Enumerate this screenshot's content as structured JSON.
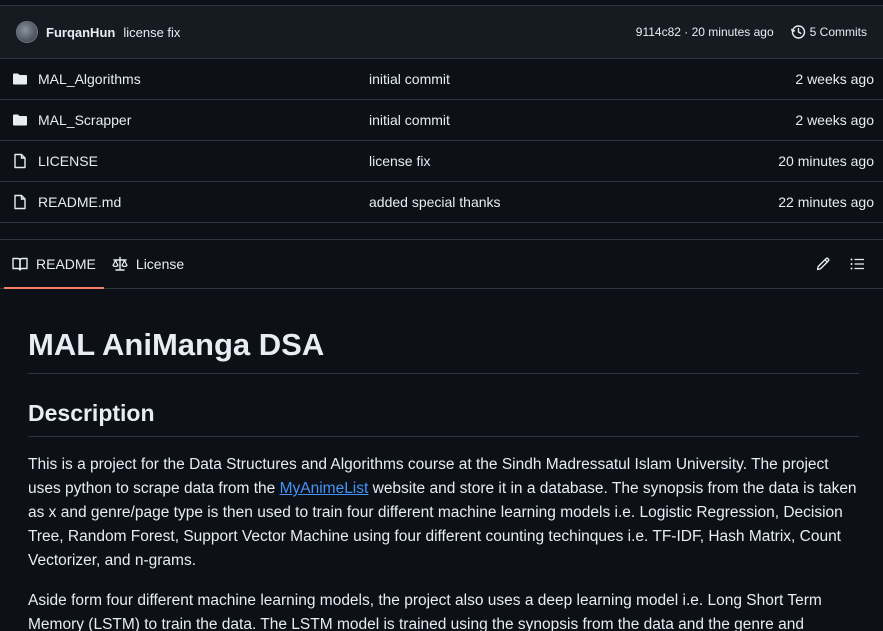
{
  "commit": {
    "author": "FurqanHun",
    "message": "license fix",
    "hash_time": "9114c82 · 20 minutes ago",
    "commits_label": "5 Commits"
  },
  "files": [
    {
      "name": "MAL_Algorithms",
      "type": "folder",
      "commit": "initial commit",
      "age": "2 weeks ago"
    },
    {
      "name": "MAL_Scrapper",
      "type": "folder",
      "commit": "initial commit",
      "age": "2 weeks ago"
    },
    {
      "name": "LICENSE",
      "type": "file",
      "commit": "license fix",
      "age": "20 minutes ago"
    },
    {
      "name": "README.md",
      "type": "file",
      "commit": "added special thanks",
      "age": "22 minutes ago"
    }
  ],
  "readme_tabs": {
    "readme": "README",
    "license": "License"
  },
  "readme": {
    "title": "MAL AniManga DSA",
    "section_heading": "Description",
    "p1_before": "This is a project for the Data Structures and Algorithms course at the Sindh Madressatul Islam University. The project uses python to scrape data from the ",
    "p1_link": "MyAnimeList",
    "p1_after": " website and store it in a database. The synopsis from the data is taken as x and genre/page type is then used to train four different machine learning models i.e. Logistic Regression, Decision Tree, Random Forest, Support Vector Machine using four different counting techinques i.e. TF-IDF, Hash Matrix, Count Vectorizer, and n-grams.",
    "p2": "Aside form four different machine learning models, the project also uses a deep learning model i.e. Long Short Term Memory (LSTM) to train the data. The LSTM model is trained using the synopsis from the data and the genre and"
  }
}
